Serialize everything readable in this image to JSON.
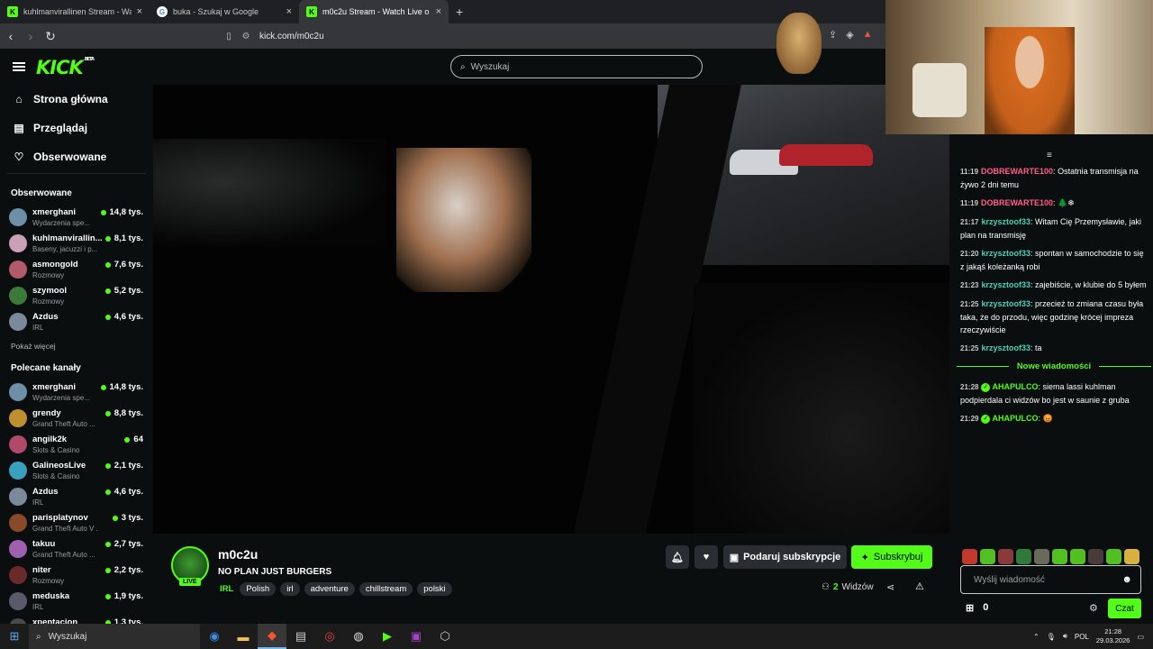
{
  "browser": {
    "tabs": [
      {
        "title": "kuhlmanvirallinen Stream - Watch",
        "icon": "kick-icon",
        "active": false
      },
      {
        "title": "buka - Szukaj w Google",
        "icon": "google-icon",
        "active": false
      },
      {
        "title": "m0c2u Stream - Watch Live o",
        "icon": "kick-icon",
        "active": true
      }
    ],
    "url": "kick.com/m0c2u"
  },
  "header": {
    "logo": "KICK",
    "logo_beta": "BETA",
    "search_placeholder": "Wyszukaj"
  },
  "sidebar": {
    "nav": [
      {
        "label": "Strona główna",
        "icon": "home-icon"
      },
      {
        "label": "Przeglądaj",
        "icon": "browse-icon"
      },
      {
        "label": "Obserwowane",
        "icon": "heart-icon"
      }
    ],
    "following_heading": "Obserwowane",
    "following": [
      {
        "name": "xmerghani",
        "category": "Wydarzenia spe...",
        "viewers": "14,8 tys.",
        "color": "#6d8fa8"
      },
      {
        "name": "kuhlmanvirallin...",
        "category": "Baseny, jacuzzi i p...",
        "viewers": "8,1 tys.",
        "color": "#c9a0b8"
      },
      {
        "name": "asmongold",
        "category": "Rozmowy",
        "viewers": "7,6 tys.",
        "color": "#b05a6a"
      },
      {
        "name": "szymool",
        "category": "Rozmowy",
        "viewers": "5,2 tys.",
        "color": "#3c7a3c"
      },
      {
        "name": "Azdus",
        "category": "IRL",
        "viewers": "4,6 tys.",
        "color": "#7a8a9a"
      }
    ],
    "show_more": "Pokaż więcej",
    "recommended_heading": "Polecane kanały",
    "recommended": [
      {
        "name": "xmerghani",
        "category": "Wydarzenia spe...",
        "viewers": "14,8 tys.",
        "color": "#6d8fa8"
      },
      {
        "name": "grendy",
        "category": "Grand Theft Auto ...",
        "viewers": "8,8 tys.",
        "color": "#c09030"
      },
      {
        "name": "angilk2k",
        "category": "Slots & Casino",
        "viewers": "64",
        "color": "#b04a6a"
      },
      {
        "name": "GalineosLive",
        "category": "Slots & Casino",
        "viewers": "2,1 tys.",
        "color": "#3aa0c0"
      },
      {
        "name": "Azdus",
        "category": "IRL",
        "viewers": "4,6 tys.",
        "color": "#7a8a9a"
      },
      {
        "name": "parisplatynov",
        "category": "Grand Theft Auto V ...",
        "viewers": "3 tys.",
        "color": "#8a4a2a"
      },
      {
        "name": "takuu",
        "category": "Grand Theft Auto ...",
        "viewers": "2,7 tys.",
        "color": "#a060b0"
      },
      {
        "name": "niter",
        "category": "Rozmowy",
        "viewers": "2,2 tys.",
        "color": "#6a2a2a"
      },
      {
        "name": "meduska",
        "category": "IRL",
        "viewers": "1,9 tys.",
        "color": "#5a5a6a"
      },
      {
        "name": "xpentacion",
        "category": "",
        "viewers": "1,3 tys.",
        "color": "#4a4a4a"
      }
    ]
  },
  "stream": {
    "channel": "m0c2u",
    "title": "NO PLAN JUST BURGERS",
    "live_badge": "LIVE",
    "category": "IRL",
    "tags": [
      "Polish",
      "irl",
      "adventure",
      "chillstream",
      "polski"
    ],
    "gift_label": "Podaruj subskrypcje",
    "subscribe_label": "Subskrybuj",
    "viewers_count": "2",
    "viewers_label": "Widzów"
  },
  "chat": {
    "messages": [
      {
        "time": "11:19",
        "user": "DOBREWARTE100",
        "color": "#ff5e8a",
        "text": "Ostatnia transmisja na żywo 2 dni temu"
      },
      {
        "time": "11:19",
        "user": "DOBREWARTE100",
        "color": "#ff5e8a",
        "text": "🌲❄"
      },
      {
        "time": "21:17",
        "user": "krzysztoof33",
        "color": "#45d3b8",
        "text": "Witam Cię Przemysławie, jaki plan na transmisję"
      },
      {
        "time": "21:20",
        "user": "krzysztoof33",
        "color": "#45d3b8",
        "text": "spontan w samochodzie to się z jakąś koleżanką robi"
      },
      {
        "time": "21:23",
        "user": "krzysztoof33",
        "color": "#45d3b8",
        "text": "zajebiście, w klubie do 5 byłem"
      },
      {
        "time": "21:25",
        "user": "krzysztoof33",
        "color": "#45d3b8",
        "text": "przecież to zmiana czasu była taka, że do przodu, więc godzinę krócej impreza rzeczywiście"
      },
      {
        "time": "21:25",
        "user": "krzysztoof33",
        "color": "#45d3b8",
        "text": "ta"
      }
    ],
    "new_messages_label": "Nowe wiadomości",
    "new_messages": [
      {
        "time": "21:28",
        "user": "AHAPULCO",
        "color": "#53fc18",
        "text": "siema lassi kuhlman podpierdala ci widzów bo jest w saunie z gruba"
      },
      {
        "time": "21:29",
        "user": "AHAPULCO",
        "color": "#53fc18",
        "text": "😡"
      }
    ],
    "input_placeholder": "Wyślij wiadomość",
    "kicks_count": "0",
    "send_label": "Czat"
  },
  "taskbar": {
    "search": "Wyszukaj",
    "lang": "POL",
    "time": "21:28",
    "date": "29.03.2026"
  },
  "colors": {
    "accent": "#53fc18",
    "background": "#0b0e0f"
  }
}
